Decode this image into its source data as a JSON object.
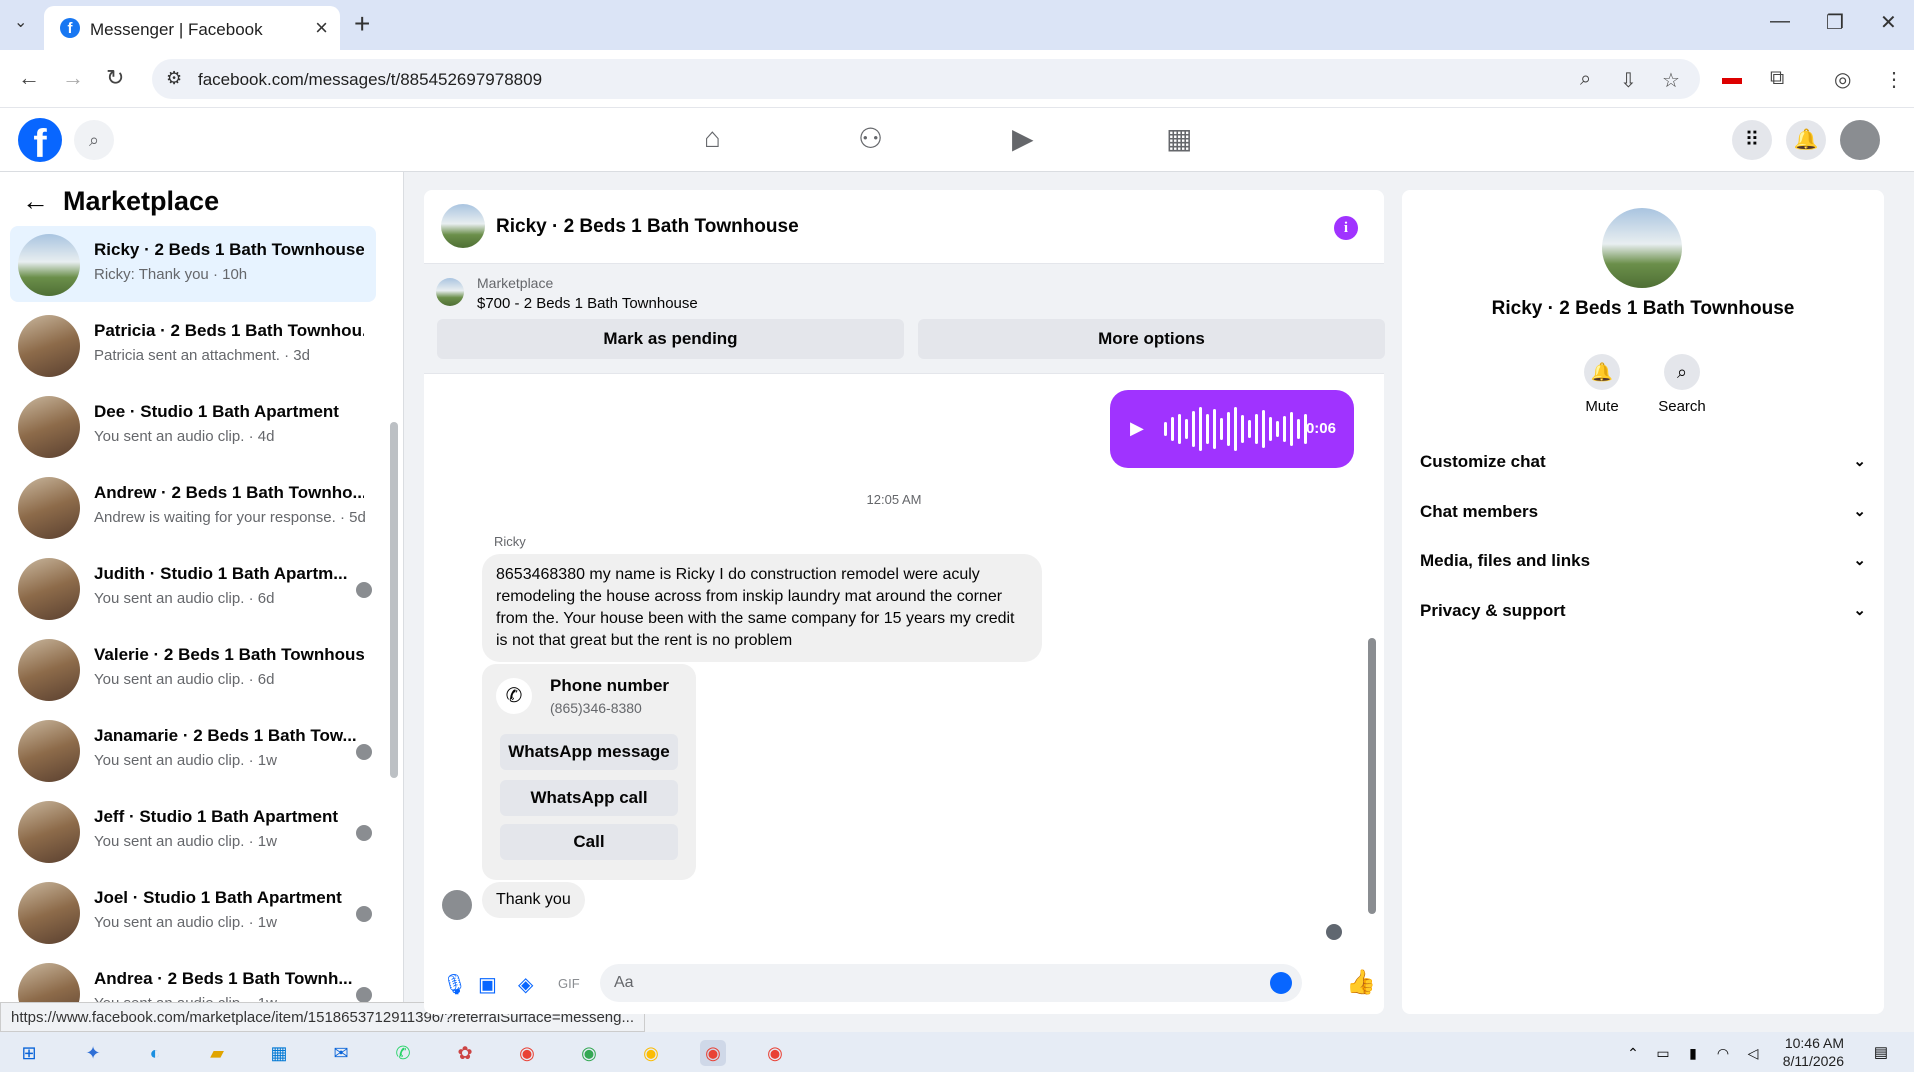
{
  "browser": {
    "tab_title": "Messenger | Facebook",
    "url": "facebook.com/messages/t/885452697978809",
    "status_url": "https://www.facebook.com/marketplace/item/1518653712911396/?referralSurface=messeng..."
  },
  "left": {
    "heading": "Marketplace",
    "conversations": [
      {
        "name": "Ricky · 2 Beds 1 Bath Townhouse",
        "snippet": "Ricky: Thank you · 10h",
        "selected": true
      },
      {
        "name": "Patricia · 2 Beds 1 Bath Townhou...",
        "snippet": "Patricia sent an attachment. · 3d"
      },
      {
        "name": "Dee · Studio 1 Bath Apartment",
        "snippet": "You sent an audio clip. · 4d"
      },
      {
        "name": "Andrew · 2 Beds 1 Bath Townho...",
        "snippet": "Andrew is waiting for your response. · 5d"
      },
      {
        "name": "Judith · Studio 1 Bath Apartm...",
        "snippet": "You sent an audio clip. · 6d"
      },
      {
        "name": "Valerie · 2 Beds 1 Bath Townhouse",
        "snippet": "You sent an audio clip. · 6d"
      },
      {
        "name": "Janamarie · 2 Beds 1 Bath Tow...",
        "snippet": "You sent an audio clip. · 1w"
      },
      {
        "name": "Jeff · Studio 1 Bath Apartment",
        "snippet": "You sent an audio clip. · 1w"
      },
      {
        "name": "Joel · Studio 1 Bath Apartment",
        "snippet": "You sent an audio clip. · 1w"
      },
      {
        "name": "Andrea · 2 Beds 1 Bath Townh...",
        "snippet": "You sent an audio clip. · 1w"
      }
    ]
  },
  "chat": {
    "title": "Ricky · 2 Beds 1 Bath Townhouse",
    "marketplace_label": "Marketplace",
    "listing": "$700 - 2 Beds 1 Bath Townhouse",
    "mark_pending": "Mark as pending",
    "more_options": "More options",
    "audio_duration": "0:06",
    "timestamp": "12:05 AM",
    "sender": "Ricky",
    "message": "8653468380 my name is Ricky I do construction remodel were aculy remodeling the house across from inskip laundry mat around the corner from the. Your house been with the same company for 15 years  my credit is not that great but the rent is no problem",
    "phone_label": "Phone number",
    "phone_number": "(865)346-8380",
    "whatsapp_message": "WhatsApp message",
    "whatsapp_call": "WhatsApp call",
    "call": "Call",
    "last_message": "Thank you",
    "input_placeholder": "Aa"
  },
  "right": {
    "name": "Ricky · 2 Beds 1 Bath Townhouse",
    "mute": "Mute",
    "search": "Search",
    "sections": [
      "Customize chat",
      "Chat members",
      "Media, files and links",
      "Privacy & support"
    ]
  },
  "taskbar": {
    "time": "10:46 AM",
    "date": "8/11/2026"
  },
  "colors": {
    "accent": "#a033ff",
    "fb_blue": "#0866ff",
    "selected_bg": "#e7f3ff"
  }
}
